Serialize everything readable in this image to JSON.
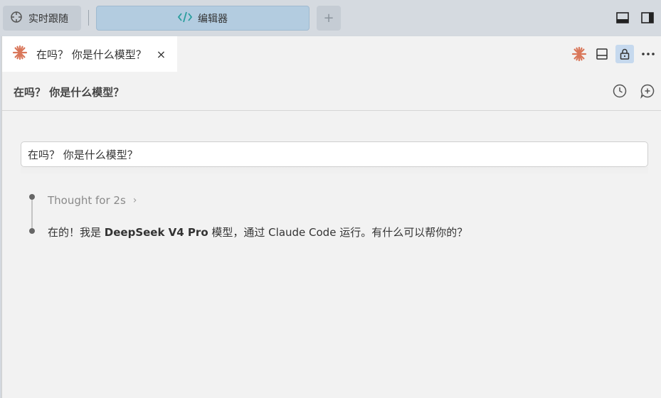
{
  "titlebar": {
    "follow_label": "实时跟随",
    "editor_label": "编辑器",
    "add_label": "+"
  },
  "tab": {
    "title": "在吗？ 你是什么模型？",
    "close": "×"
  },
  "header": {
    "title": "在吗？ 你是什么模型？"
  },
  "prompt": {
    "text": "在吗？ 你是什么模型？"
  },
  "thought": {
    "label": "Thought for 2s",
    "chevron": "›"
  },
  "answer": {
    "part1": "在的！我是 ",
    "model": "DeepSeek V4 Pro",
    "part2": " 模型，通过 Claude Code 运行。有什么可以帮你的？"
  },
  "icons": {
    "follow": "crosshair-icon",
    "editor": "code-icon",
    "layout_bottom": "panel-bottom-icon",
    "layout_right": "panel-right-icon",
    "claude": "claude-spark-icon",
    "split": "split-panel-icon",
    "lock": "lock-icon",
    "more": "more-icon",
    "history": "history-icon",
    "new_chat": "new-chat-icon"
  },
  "colors": {
    "accent_orange": "#d9775a",
    "editor_tab_bg": "#b3cce0",
    "code_icon": "#2b9e9e",
    "lock_active_bg": "#c6d9ee"
  }
}
